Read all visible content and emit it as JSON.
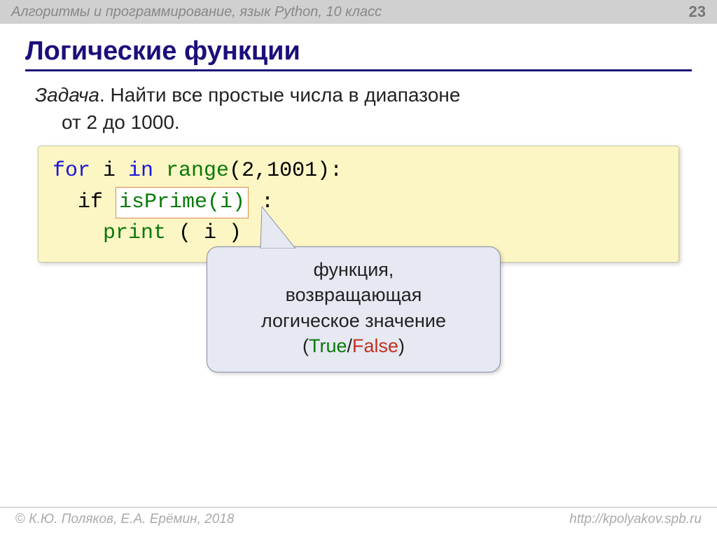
{
  "header": {
    "subject": "Алгоритмы и программирование, язык Python, 10 класс",
    "page": "23"
  },
  "title": "Логические функции",
  "task": {
    "label": "Задача",
    "text1": ". Найти все простые числа в диапазоне",
    "text2": "от 2 до 1000."
  },
  "code": {
    "l1a": "for",
    "l1b": " i ",
    "l1c": "in",
    "l1d": " range",
    "l1e": "(2,1001):",
    "l2a": "  if ",
    "l2b": "isPrime(i)",
    "l2c": " :",
    "l3a": "    ",
    "l3b": "print",
    "l3c": " ( i )"
  },
  "callout": {
    "line1": "функция,",
    "line2": "возвращающая",
    "line3": "логическое значение",
    "true": "True",
    "sep": "/",
    "false": "False",
    "open": "(",
    "close": ")"
  },
  "footer": {
    "copy": "©",
    "left": " К.Ю. Поляков, Е.А. Ерёмин, 2018",
    "right": "http://kpolyakov.spb.ru"
  }
}
